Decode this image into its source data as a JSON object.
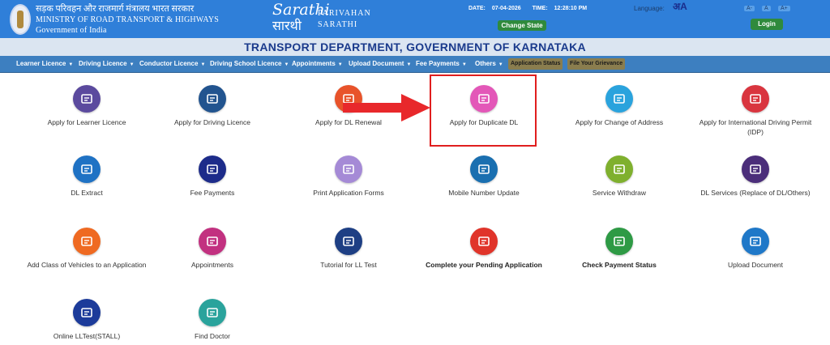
{
  "header": {
    "ministry_hi": "सड़क परिवहन और राजमार्ग मंत्रालय भारत सरकार",
    "ministry_en": "MINISTRY OF ROAD TRANSPORT & HIGHWAYS",
    "govt": "Government of India",
    "logo_script_top": "Sarathi",
    "logo_script_bottom": "सारथी",
    "logo_line1": "PARIVAHAN",
    "logo_line2": "SARATHI",
    "date_label": "DATE:",
    "date_value": "07-04-2026",
    "time_label": "TIME:",
    "time_value": "12:28:10 PM",
    "change_state": "Change State",
    "language_label": "Language:",
    "language_icon": "अA",
    "font_small": "A-",
    "font_normal": "A",
    "font_large": "A+",
    "login": "Login"
  },
  "department": "TRANSPORT DEPARTMENT, GOVERNMENT OF KARNATAKA",
  "nav": [
    "Learner Licence",
    "Driving Licence",
    "Conductor Licence",
    "Driving School Licence",
    "Appointments",
    "Upload Document",
    "Fee Payments",
    "Others"
  ],
  "nav_buttons": [
    "Application Status",
    "File Your Grievance"
  ],
  "tiles": [
    {
      "label": "Apply for Learner Licence",
      "color": "#5b4a9e",
      "icon": "learner-licence-icon"
    },
    {
      "label": "Apply for Driving Licence",
      "color": "#22548f",
      "icon": "driving-licence-icon"
    },
    {
      "label": "Apply for DL Renewal",
      "color": "#e8532a",
      "icon": "dl-renewal-icon"
    },
    {
      "label": "Apply for Duplicate DL",
      "color": "#e357b8",
      "icon": "duplicate-dl-icon"
    },
    {
      "label": "Apply for Change of Address",
      "color": "#2aa3dd",
      "icon": "change-address-icon"
    },
    {
      "label": "Apply for International Driving Permit (IDP)",
      "color": "#d9353f",
      "icon": "idp-icon"
    },
    {
      "label": "DL Extract",
      "color": "#1f72c4",
      "icon": "dl-extract-icon"
    },
    {
      "label": "Fee Payments",
      "color": "#1d2c8a",
      "icon": "fee-payments-icon"
    },
    {
      "label": "Print Application Forms",
      "color": "#a58ad6",
      "icon": "print-forms-icon"
    },
    {
      "label": "Mobile Number Update",
      "color": "#1a6fb0",
      "icon": "mobile-update-icon"
    },
    {
      "label": "Service Withdraw",
      "color": "#7fb02e",
      "icon": "service-withdraw-icon"
    },
    {
      "label": "DL Services (Replace of DL/Others)",
      "color": "#4b2e7a",
      "icon": "dl-services-icon"
    },
    {
      "label": "Add Class of Vehicles to an Application",
      "color": "#ef6a22",
      "icon": "add-class-icon"
    },
    {
      "label": "Appointments",
      "color": "#c23180",
      "icon": "appointments-icon"
    },
    {
      "label": "Tutorial for LL Test",
      "color": "#1e3f84",
      "icon": "tutorial-icon"
    },
    {
      "label": "Complete your Pending Application",
      "color": "#e0342a",
      "icon": "pending-application-icon",
      "bold": true
    },
    {
      "label": "Check Payment Status",
      "color": "#2e9a45",
      "icon": "payment-status-icon",
      "bold": true
    },
    {
      "label": "Upload Document",
      "color": "#1f78c8",
      "icon": "upload-document-icon"
    },
    {
      "label": "Online LLTest(STALL)",
      "color": "#1c3b9a",
      "icon": "online-lltest-icon"
    },
    {
      "label": "Find Doctor",
      "color": "#2aa39c",
      "icon": "find-doctor-icon"
    }
  ]
}
